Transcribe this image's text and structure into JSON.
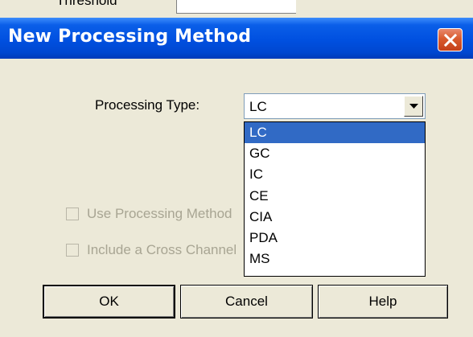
{
  "background_window": {
    "partial_label": "Threshold"
  },
  "dialog": {
    "title": "New Processing Method",
    "processing_type_label": "Processing Type:",
    "processing_type_value": "LC",
    "dropdown_options": [
      "LC",
      "GC",
      "IC",
      "CE",
      "CIA",
      "PDA",
      "MS"
    ],
    "selected_option_index": 0,
    "checkbox_use_label": "Use Processing Method",
    "checkbox_use_checked": false,
    "checkbox_include_label": "Include a Cross Channel",
    "checkbox_include_checked": false,
    "ok_label": "OK",
    "cancel_label": "Cancel",
    "help_label": "Help"
  },
  "colors": {
    "titlebar": "#0050e0",
    "selection": "#316ac5",
    "dialog_bg": "#ece9d8",
    "close_button": "#d95b2e"
  }
}
